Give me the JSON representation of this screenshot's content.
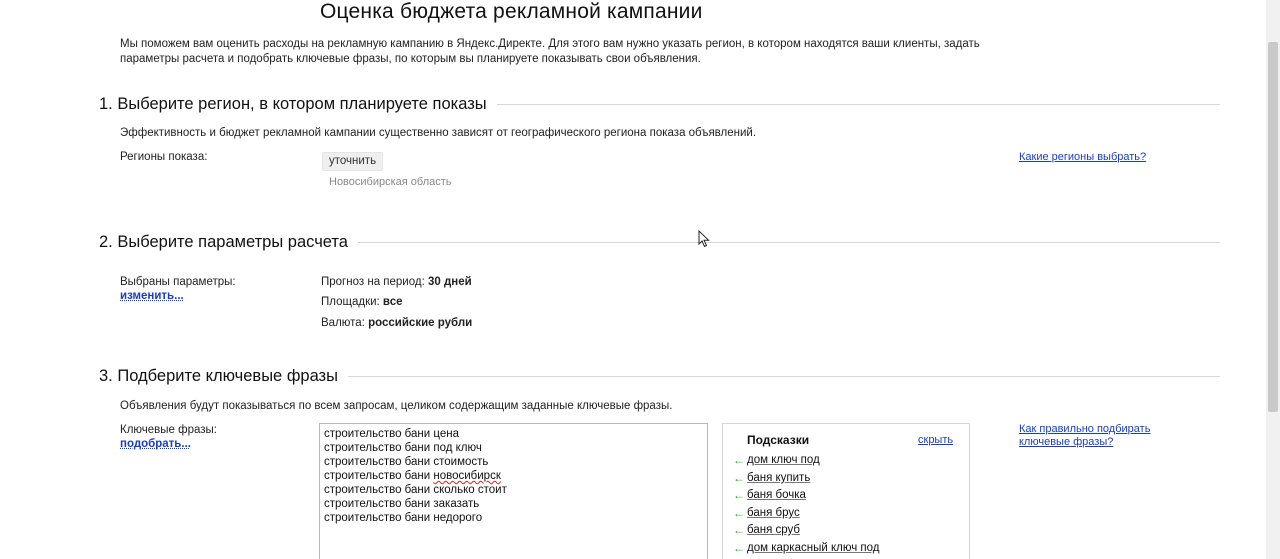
{
  "page": {
    "title": "Оценка бюджета рекламной кампании",
    "intro": "Мы поможем вам оценить расходы на рекламную кампанию в Яндекс.Директе. Для этого вам нужно указать регион, в котором находятся ваши клиенты, задать параметры расчета и подобрать ключевые фразы, по которым вы планируете показывать свои объявления."
  },
  "section1": {
    "title": "1. Выберите регион, в котором планируете показы",
    "description": "Эффективность и бюджет рекламной кампании существенно зависят от географического региона показа объявлений.",
    "regions_label": "Регионы показа:",
    "refine_button": "уточнить",
    "selected_region": "Новосибирская область",
    "help_link": "Какие регионы выбрать?"
  },
  "section2": {
    "title": "2. Выберите параметры расчета",
    "selected_label": "Выбраны параметры:",
    "change_link": "изменить...",
    "params": [
      {
        "label": "Прогноз на период:",
        "value": "30 дней"
      },
      {
        "label": "Площадки:",
        "value": "все"
      },
      {
        "label": "Валюта:",
        "value": "российские рубли"
      }
    ]
  },
  "section3": {
    "title": "3. Подберите ключевые фразы",
    "description": "Объявления будут показываться по всем запросам, целиком содержащим заданные ключевые фразы.",
    "keywords_label": "Ключевые фразы:",
    "pick_link": "подобрать...",
    "keywords": [
      "строительство бани цена",
      "строительство бани под ключ",
      "строительство бани стоимость",
      "строительство бани новосибирск",
      "строительство бани сколько стоит",
      "строительство бани заказать",
      "строительство бани недорого"
    ],
    "hints_title": "Подсказки",
    "hints_hide": "скрыть",
    "hints": [
      "дом ключ под",
      "баня купить",
      "баня бочка",
      "баня брус",
      "баня сруб",
      "дом каркасный ключ под"
    ],
    "help_link": "Как правильно подбирать ключевые фразы?"
  },
  "colors": {
    "link": "#1a3dc1",
    "hint_arrow": "#3aa53a",
    "rule": "#d8d8d8"
  }
}
